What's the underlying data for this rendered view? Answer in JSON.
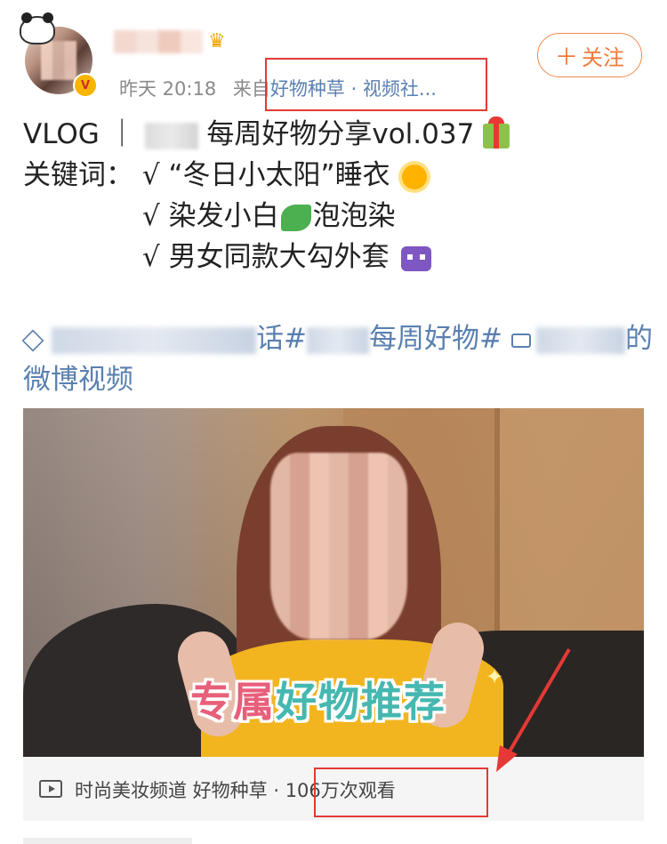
{
  "post": {
    "time": "昨天 20:18",
    "source_prefix": "来自",
    "source": "好物种草 · 视频社...",
    "follow_label": "关注",
    "follow_plus": "＋",
    "lines": {
      "title_prefix": "VLOG ｜",
      "title_suffix": "每周好物分享vol.037",
      "kw_label": "关键词：",
      "kw1": "√ “冬日小太阳”睡衣",
      "kw2_a": "√ 染发小白",
      "kw2_b": "泡泡染",
      "kw3": "√ 男女同款大勾外套"
    },
    "topics": {
      "t1": "话#",
      "t2": "每周好物#",
      "t3": "的",
      "line2": "微博视频"
    }
  },
  "video": {
    "caption_part1": "专属",
    "caption_part2": "好物推荐",
    "meta": "时尚美妆频道 好物种草 · 106万次观看"
  },
  "icons": {
    "crown": "crown-icon",
    "gift": "gift-icon",
    "sun": "sun-icon",
    "lettuce": "lettuce-icon",
    "alien": "alien-icon",
    "diamond": "diamond-icon",
    "video_cam": "video-camera-icon",
    "play": "play-icon"
  },
  "colors": {
    "follow": "#f07a3b",
    "link": "#5a80b0",
    "annotation": "#e53935"
  }
}
